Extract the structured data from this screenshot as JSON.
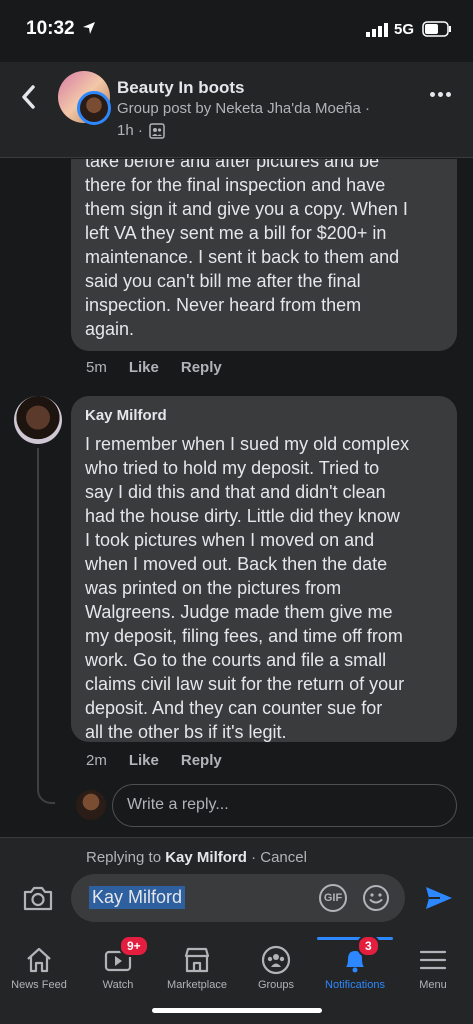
{
  "status_bar": {
    "time": "10:32",
    "network": "5G"
  },
  "header": {
    "title": "Beauty In boots",
    "subtitle": "Group post by Neketa Jha'da Moeña ·",
    "time": "1h ·"
  },
  "comments": [
    {
      "text": "take before and after pictures and be\nthere for the final inspection and have\nthem sign it and give you a copy. When I\nleft VA they sent me a bill for $200+ in\nmaintenance. I sent it back to them and\nsaid you can't bill me after the final\ninspection. Never heard from them\nagain.",
      "time": "5m",
      "like": "Like",
      "reply": "Reply"
    },
    {
      "author": "Kay Milford",
      "text": "I remember when I sued my old complex\nwho tried to hold my deposit.  Tried to\nsay I did this and that and didn't clean\nhad the house dirty.  Little did they know\nI took pictures when I moved on and\nwhen I moved out.  Back then the date\nwas printed on the pictures from\nWalgreens.  Judge made them give me\nmy deposit, filing fees, and time off from\nwork.  Go to the courts and file a small\nclaims civil law suit for the return of your\ndeposit.  And they can counter sue for\nall the other bs if it's legit.",
      "time": "2m",
      "like": "Like",
      "reply": "Reply"
    }
  ],
  "reply_placeholder": "Write a reply...",
  "composer": {
    "replying_prefix": "Replying to",
    "replying_name": "Kay Milford",
    "cancel": "· Cancel",
    "mention": "Kay Milford",
    "gif": "GIF"
  },
  "tabs": [
    {
      "label": "News Feed",
      "icon": "home-icon"
    },
    {
      "label": "Watch",
      "icon": "video-icon",
      "badge": "9+"
    },
    {
      "label": "Marketplace",
      "icon": "shop-icon"
    },
    {
      "label": "Groups",
      "icon": "groups-icon"
    },
    {
      "label": "Notifications",
      "icon": "bell-icon",
      "badge": "3",
      "active": true
    },
    {
      "label": "Menu",
      "icon": "menu-icon"
    }
  ],
  "colors": {
    "accent": "#2d88ff",
    "badge": "#e41e3f",
    "bubble": "#3a3b3c"
  }
}
